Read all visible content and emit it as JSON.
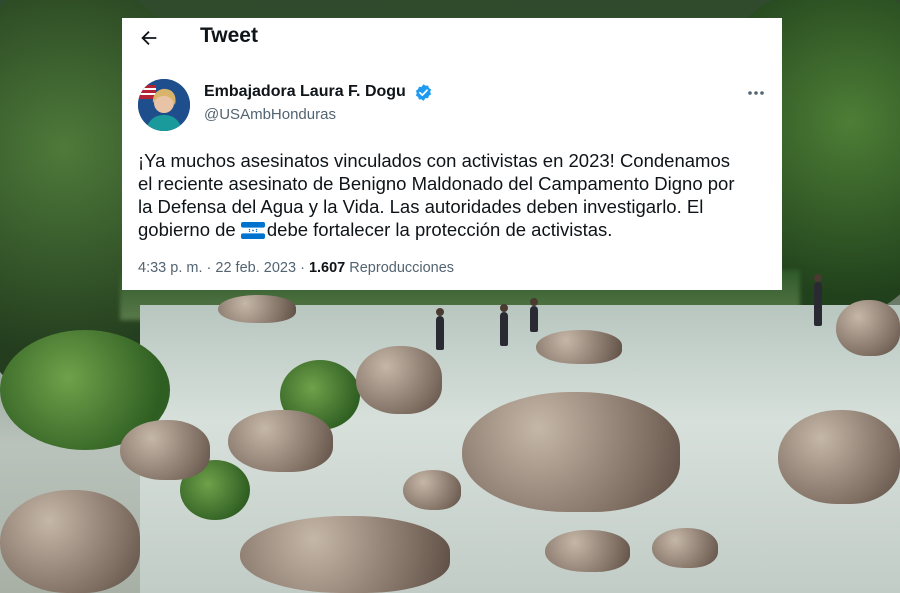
{
  "header": {
    "title": "Tweet"
  },
  "author": {
    "display_name": "Embajadora Laura F. Dogu",
    "handle": "@USAmbHonduras",
    "verified_icon": "verified-badge-icon",
    "verified_color": "#1d9bf0"
  },
  "tweet": {
    "lines": [
      "¡Ya muchos asesinatos vinculados con activistas en 2023! Condenamos",
      "el reciente asesinato de Benigno Maldonado del Campamento Digno por",
      "la Defensa del Agua y la Vida. Las autoridades deben investigarlo. El",
      "gobierno de "
    ],
    "line_after_flag": "debe fortalecer la protección de activistas.",
    "inline_flag": "honduras-flag-icon"
  },
  "meta": {
    "time": "4:33 p. m.",
    "separator": "·",
    "date": "22 feb. 2023",
    "views_count": "1.607",
    "views_label": "Reproducciones"
  },
  "colors": {
    "text_primary": "#0f1419",
    "text_secondary": "#536471",
    "card_background": "#ffffff"
  }
}
